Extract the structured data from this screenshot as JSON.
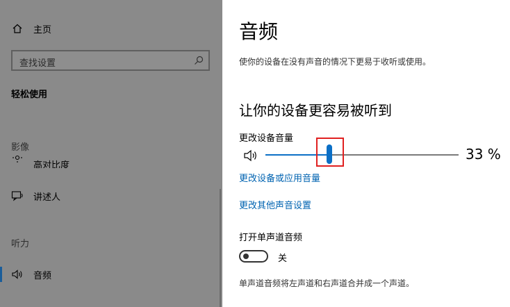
{
  "sidebar": {
    "home_label": "主页",
    "search_placeholder": "查找设置",
    "category": "轻松使用",
    "section_vision": "影像",
    "item_contrast": "高对比度",
    "item_narrator": "讲述人",
    "section_hearing": "听力",
    "item_audio": "音频"
  },
  "main": {
    "title": "音频",
    "description": "使你的设备在没有声音的情况下更易于收听或使用。",
    "section_title": "让你的设备更容易被听到",
    "volume_label": "更改设备音量",
    "volume_value": 33,
    "volume_text": "33 %",
    "link_app_volume": "更改设备或应用音量",
    "link_other_sound": "更改其他声音设置",
    "mono_label": "打开单声道音频",
    "mono_state": "关",
    "mono_note": "单声道音频将左声道和右声道合并成一个声道。"
  },
  "colors": {
    "accent": "#0b6fc6",
    "link": "#0063b1",
    "highlight": "#e02020"
  },
  "icons": {
    "home": "home-icon",
    "search": "search-icon",
    "contrast": "contrast-icon",
    "narrator": "narrator-icon",
    "audio": "speaker-icon"
  }
}
